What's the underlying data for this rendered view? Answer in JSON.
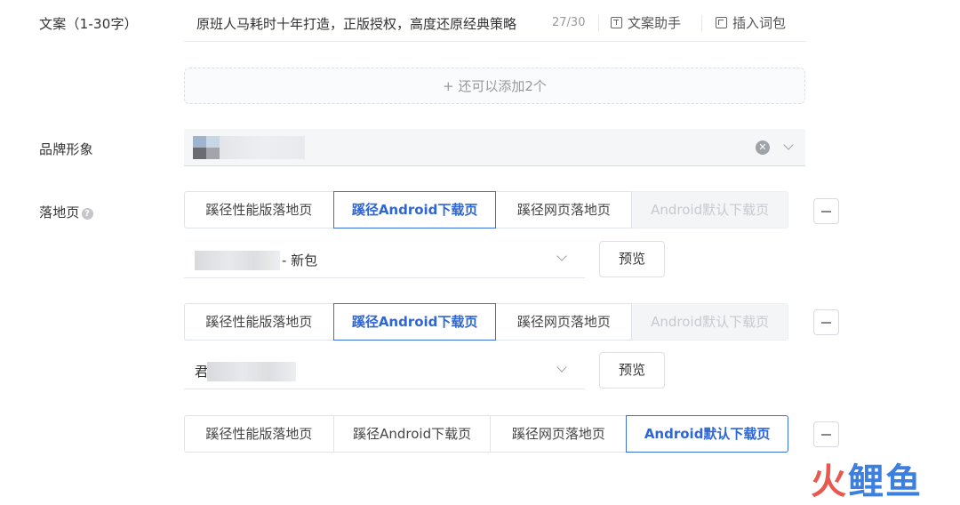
{
  "copy": {
    "label": "文案（1-30字）",
    "value": "原班人马耗时十年打造，正版授权，高度还原经典策略",
    "count": "27/30",
    "tools": [
      {
        "label": "文案助手",
        "icon": "text-icon"
      },
      {
        "label": "插入词包",
        "icon": "word-pack-icon"
      }
    ]
  },
  "add_more": "+ 还可以添加2个",
  "brand": {
    "label": "品牌形象"
  },
  "landing": {
    "label": "落地页",
    "groups": [
      {
        "tabs": [
          "蹊径性能版落地页",
          "蹊径Android下载页",
          "蹊径网页落地页",
          "Android默认下载页"
        ],
        "active": 1,
        "disabled": [
          3
        ],
        "package": {
          "suffix": "- 新包"
        },
        "preview": "预览"
      },
      {
        "tabs": [
          "蹊径性能版落地页",
          "蹊径Android下载页",
          "蹊径网页落地页",
          "Android默认下载页"
        ],
        "active": 1,
        "disabled": [
          3
        ],
        "package": {
          "prefix": "君"
        },
        "preview": "预览"
      },
      {
        "tabs": [
          "蹊径性能版落地页",
          "蹊径Android下载页",
          "蹊径网页落地页",
          "Android默认下载页"
        ],
        "active": 3,
        "disabled": []
      }
    ]
  },
  "watermark": {
    "part1": "火",
    "part2": "鲤鱼"
  },
  "colors": {
    "accent": "#2f66d6",
    "disabled_bg": "#f4f5f7",
    "watermark_red": "#e8584e",
    "watermark_blue": "#3b7fe0"
  }
}
